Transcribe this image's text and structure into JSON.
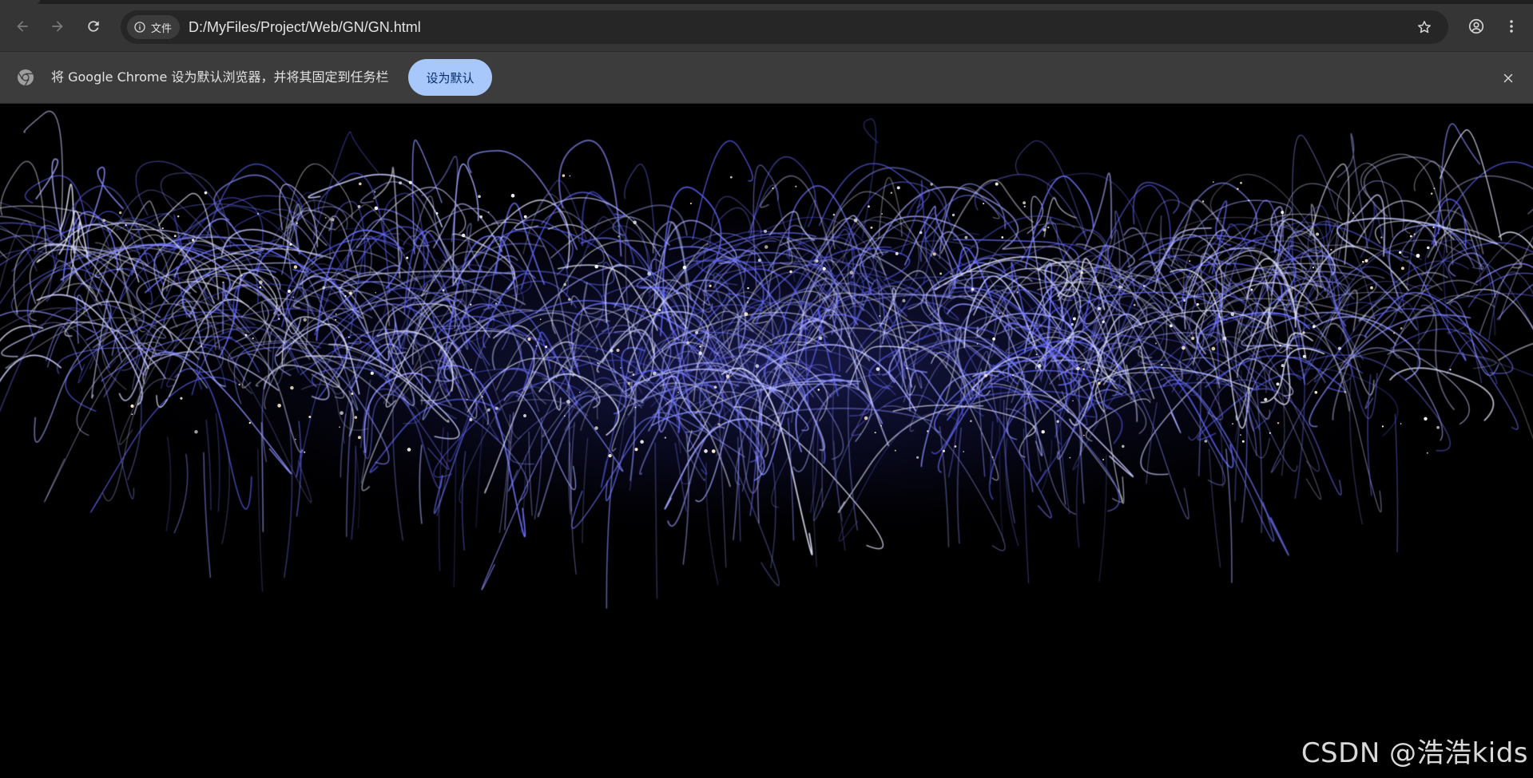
{
  "browser": {
    "nav": {
      "back_icon": "arrow-left-icon",
      "forward_icon": "arrow-right-icon",
      "reload_icon": "reload-icon"
    },
    "omnibox": {
      "site_info_icon": "info-circle-icon",
      "site_chip_label": "文件",
      "url": "D:/MyFiles/Project/Web/GN/GN.html",
      "bookmark_icon": "star-icon"
    },
    "profile_icon": "account-circle-icon",
    "menu_icon": "kebab-menu-icon",
    "colors": {
      "toolbar_bg": "#353535",
      "omnibox_bg": "#262626",
      "infobar_bg": "#3c3c3c",
      "accent_button": "#a8c7fa"
    }
  },
  "infobar": {
    "logo_icon": "chrome-logo-icon",
    "message": "将 Google Chrome 设为默认浏览器，并将其固定到任务栏",
    "set_default_label": "设为默认",
    "close_icon": "close-icon"
  },
  "page": {
    "content_description_icon": "fireworks-image",
    "firework_color": "#6f74ff",
    "background_color": "#000000",
    "watermark": "CSDN @浩浩kids"
  }
}
